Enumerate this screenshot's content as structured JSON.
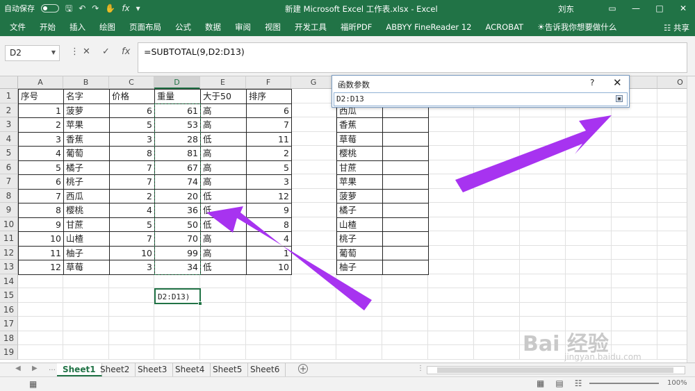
{
  "title_bar": {
    "autosave_label": "自动保存",
    "autosave_state": "关",
    "title": "新建 Microsoft Excel 工作表.xlsx  -  Excel",
    "user": "刘东",
    "icons": [
      "save-icon",
      "undo-icon",
      "redo-icon",
      "touch-mode-icon",
      "fx-icon",
      "customize-qat-icon"
    ]
  },
  "ribbon": {
    "tabs": [
      "文件",
      "开始",
      "插入",
      "绘图",
      "页面布局",
      "公式",
      "数据",
      "审阅",
      "视图",
      "开发工具",
      "福昕PDF",
      "ABBYY FineReader 12",
      "ACROBAT",
      "告诉我你想要做什么"
    ],
    "share": "共享"
  },
  "formula_bar": {
    "name_box": "D2",
    "formula": "=SUBTOTAL(9,D2:D13)"
  },
  "columns": [
    "A",
    "B",
    "C",
    "D",
    "E",
    "F",
    "G",
    "",
    "",
    "",
    "",
    "",
    "N",
    "",
    "O"
  ],
  "rows": [
    "1",
    "2",
    "3",
    "4",
    "5",
    "6",
    "7",
    "8",
    "9",
    "10",
    "11",
    "12",
    "13",
    "14",
    "15",
    "16",
    "17",
    "18",
    "19"
  ],
  "headers": [
    "序号",
    "名字",
    "价格",
    "重量",
    "大于50",
    "排序"
  ],
  "table": [
    [
      "1",
      "菠萝",
      "6",
      "61",
      "高",
      "6"
    ],
    [
      "2",
      "苹果",
      "5",
      "53",
      "高",
      "7"
    ],
    [
      "3",
      "香蕉",
      "3",
      "28",
      "低",
      "11"
    ],
    [
      "4",
      "葡萄",
      "8",
      "81",
      "高",
      "2"
    ],
    [
      "5",
      "橘子",
      "7",
      "67",
      "高",
      "5"
    ],
    [
      "6",
      "桃子",
      "7",
      "74",
      "高",
      "3"
    ],
    [
      "7",
      "西瓜",
      "2",
      "20",
      "低",
      "12"
    ],
    [
      "8",
      "樱桃",
      "4",
      "36",
      "低",
      "9"
    ],
    [
      "9",
      "甘蔗",
      "5",
      "50",
      "低",
      "8"
    ],
    [
      "10",
      "山楂",
      "7",
      "70",
      "高",
      "4"
    ],
    [
      "11",
      "柚子",
      "10",
      "99",
      "高",
      "1"
    ],
    [
      "12",
      "草莓",
      "3",
      "34",
      "低",
      "10"
    ]
  ],
  "sort_list": [
    "西瓜",
    "香蕉",
    "草莓",
    "樱桃",
    "甘蔗",
    "苹果",
    "菠萝",
    "橘子",
    "山楂",
    "桃子",
    "葡萄",
    "柚子"
  ],
  "editing_cell_text": "D2:D13)",
  "dialog": {
    "title": "函数参数",
    "help": "?",
    "input_value": "D2:D13"
  },
  "sheets": [
    "Sheet1",
    "Sheet2",
    "Sheet3",
    "Sheet4",
    "Sheet5",
    "Sheet6"
  ],
  "active_sheet": "Sheet1",
  "status": {
    "zoom": "100%"
  },
  "watermark": {
    "brand": "Bai 经验",
    "url": "jingyan.baidu.com"
  },
  "colors": {
    "excel_green": "#217346",
    "arrow_purple": "#a733f0"
  }
}
